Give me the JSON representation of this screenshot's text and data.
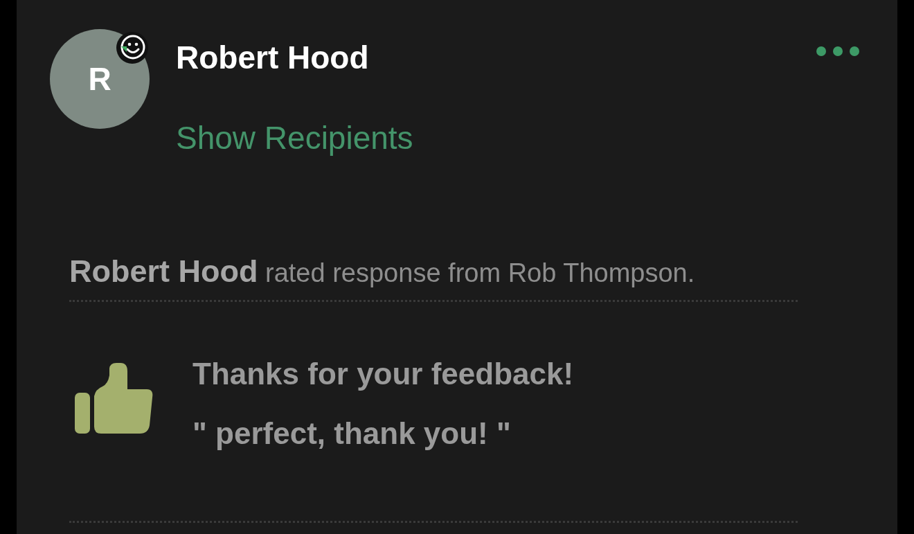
{
  "message": {
    "sender": "Robert Hood",
    "avatar_initial": "R",
    "recipients_link": "Show Recipients"
  },
  "activity": {
    "text": "**Robert Hood** rated response from Rob Thompson."
  },
  "feedback": {
    "title": "Thanks for your feedback!",
    "comment": "\" perfect, thank you! \""
  }
}
